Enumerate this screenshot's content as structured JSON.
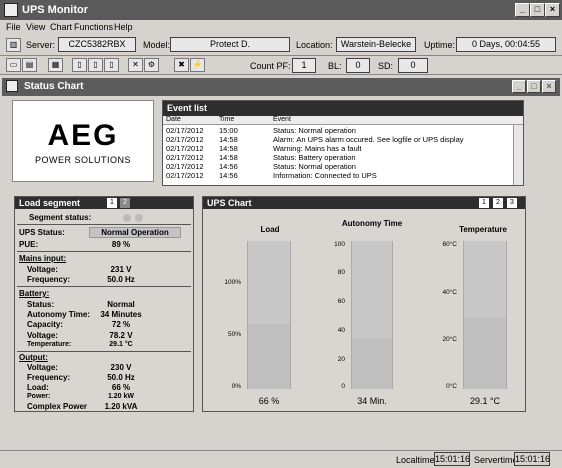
{
  "window": {
    "title": "UPS Monitor"
  },
  "menu": [
    "File",
    "View",
    "Chart",
    "Functions",
    "Help"
  ],
  "info": {
    "server_label": "Server:",
    "server": "CZC5382RBX",
    "model_label": "Model:",
    "model": "Protect D.",
    "location_label": "Location:",
    "location": "Warstein-Belecke",
    "uptime_label": "Uptime:",
    "uptime": "0 Days, 00:04:55"
  },
  "counts": {
    "pf_label": "Count PF:",
    "pf": "1",
    "bl_label": "BL:",
    "bl": "0",
    "sd_label": "SD:",
    "sd": "0"
  },
  "child": {
    "title": "Status Chart"
  },
  "logo": {
    "brand": "AEG",
    "sub": "POWER SOLUTIONS"
  },
  "events": {
    "title": "Event list",
    "headers": [
      "Date",
      "Time",
      "Event"
    ],
    "rows": [
      [
        "02/17/2012",
        "15:00",
        "Status: Normal operation"
      ],
      [
        "02/17/2012",
        "14:58",
        "Alarm: An UPS alarm occured. See logfile or UPS display"
      ],
      [
        "02/17/2012",
        "14:58",
        "Warning: Mains has a fault"
      ],
      [
        "02/17/2012",
        "14:58",
        "Status: Battery operation"
      ],
      [
        "02/17/2012",
        "14:56",
        "Status: Normal operation"
      ],
      [
        "02/17/2012",
        "14:56",
        "Information: Connected to UPS"
      ]
    ]
  },
  "load": {
    "title": "Load segment",
    "tabs": [
      "1",
      "2"
    ],
    "segment_status": "Segment status:",
    "ups_status_label": "UPS Status:",
    "ups_status": "Normal Operation",
    "pue_label": "PUE:",
    "pue": "89 %",
    "mains_title": "Mains input:",
    "voltage_label": "Voltage:",
    "voltage": "231 V",
    "freq_label": "Frequency:",
    "freq": "50.0 Hz",
    "battery_title": "Battery:",
    "b_status_label": "Status:",
    "b_status": "Normal",
    "b_auto_label": "Autonomy Time:",
    "b_auto": "34 Minutes",
    "b_cap_label": "Capacity:",
    "b_cap": "72 %",
    "b_volt_label": "Voltage:",
    "b_volt": "78.2 V",
    "b_temp_label": "Temperature:",
    "b_temp": "29.1 °C",
    "output_title": "Output:",
    "o_volt_label": "Voltage:",
    "o_volt": "230 V",
    "o_freq_label": "Frequency:",
    "o_freq": "50.0 Hz",
    "o_load_label": "Load:",
    "o_load": "66 %",
    "o_power_label": "Power:",
    "o_power": "1.20 kW",
    "o_cpower_label": "Complex Power",
    "o_cpower": "1.20 kVA"
  },
  "ups_chart": {
    "title": "UPS Chart",
    "tabs": [
      "1",
      "2",
      "3"
    ],
    "load": {
      "title": "Load",
      "ticks": [
        "100%",
        "50%",
        "0%"
      ],
      "value": 66,
      "max": 150,
      "readout": "66 %"
    },
    "autonomy": {
      "title": "Autonomy Time",
      "ticks": [
        "100",
        "80",
        "60",
        "40",
        "20",
        "0"
      ],
      "value": 34,
      "max": 100,
      "readout": "34 Min."
    },
    "temperature": {
      "title": "Temperature",
      "ticks": [
        "60°C",
        "40°C",
        "20°C",
        "0°C"
      ],
      "value": 29.1,
      "max": 60,
      "readout": "29.1 °C"
    }
  },
  "status": {
    "localtime_label": "Localtime:",
    "localtime": "15:01:16",
    "servertime_label": "Servertime:",
    "servertime": "15:01:16"
  }
}
